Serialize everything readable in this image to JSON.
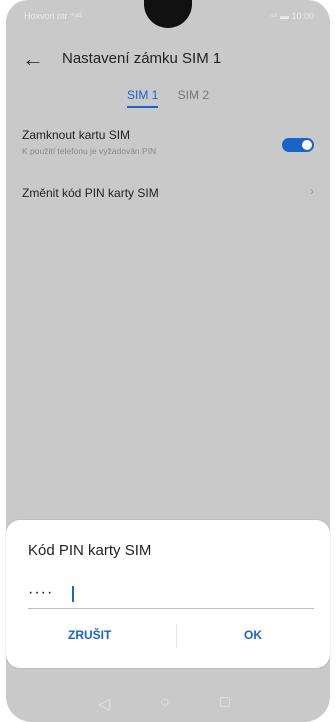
{
  "statusbar": {
    "carrier": "Hoxvon ntr ⁺ᵃᵈ",
    "right": "⁴⁵ ▬ 10:00"
  },
  "appbar": {
    "title": "Nastavení zámku SIM 1"
  },
  "tabs": [
    {
      "label": "SIM 1",
      "active": true
    },
    {
      "label": "SIM 2",
      "active": false
    }
  ],
  "settings": {
    "lock_sim": {
      "primary": "Zamknout kartu SIM",
      "secondary": "K použití telefonu je vyžadován PIN",
      "enabled": true
    },
    "change_pin": {
      "label": "Změnit kód PIN karty SIM"
    }
  },
  "dialog": {
    "title": "Kód PIN karty SIM",
    "value": "····",
    "cancel": "ZRUŠIT",
    "ok": "OK"
  },
  "navbar": {
    "back": "◁",
    "home": "○",
    "recent": "□"
  },
  "colors": {
    "accent": "#1a63c9",
    "overlay_bg": "#c9c9c9"
  },
  "icons": {
    "back": "back-arrow-icon",
    "chevron": "chevron-right-icon"
  }
}
